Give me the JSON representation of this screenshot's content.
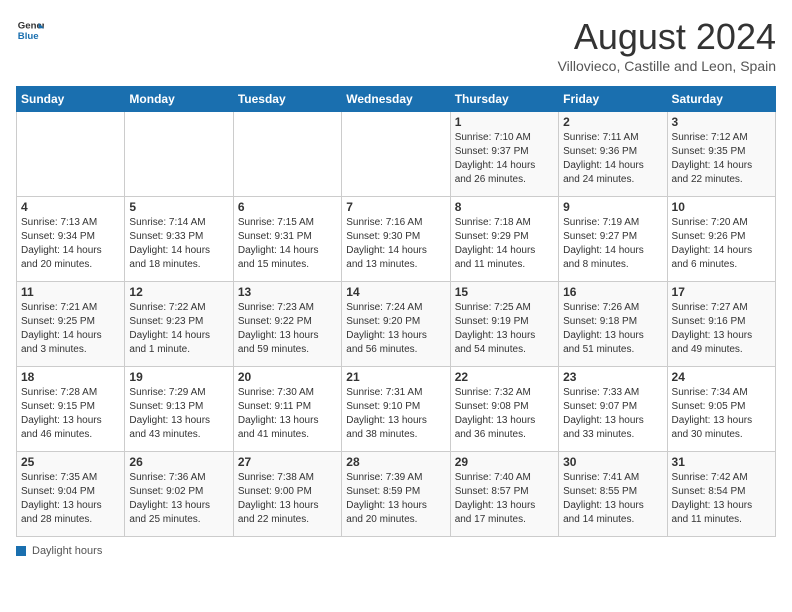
{
  "header": {
    "logo_line1": "General",
    "logo_line2": "Blue",
    "month_year": "August 2024",
    "location": "Villovieco, Castille and Leon, Spain"
  },
  "days_of_week": [
    "Sunday",
    "Monday",
    "Tuesday",
    "Wednesday",
    "Thursday",
    "Friday",
    "Saturday"
  ],
  "footer": {
    "daylight_label": "Daylight hours"
  },
  "weeks": [
    {
      "id": 1,
      "days": [
        {
          "num": "",
          "info": ""
        },
        {
          "num": "",
          "info": ""
        },
        {
          "num": "",
          "info": ""
        },
        {
          "num": "",
          "info": ""
        },
        {
          "num": "1",
          "info": "Sunrise: 7:10 AM\nSunset: 9:37 PM\nDaylight: 14 hours\nand 26 minutes."
        },
        {
          "num": "2",
          "info": "Sunrise: 7:11 AM\nSunset: 9:36 PM\nDaylight: 14 hours\nand 24 minutes."
        },
        {
          "num": "3",
          "info": "Sunrise: 7:12 AM\nSunset: 9:35 PM\nDaylight: 14 hours\nand 22 minutes."
        }
      ]
    },
    {
      "id": 2,
      "days": [
        {
          "num": "4",
          "info": "Sunrise: 7:13 AM\nSunset: 9:34 PM\nDaylight: 14 hours\nand 20 minutes."
        },
        {
          "num": "5",
          "info": "Sunrise: 7:14 AM\nSunset: 9:33 PM\nDaylight: 14 hours\nand 18 minutes."
        },
        {
          "num": "6",
          "info": "Sunrise: 7:15 AM\nSunset: 9:31 PM\nDaylight: 14 hours\nand 15 minutes."
        },
        {
          "num": "7",
          "info": "Sunrise: 7:16 AM\nSunset: 9:30 PM\nDaylight: 14 hours\nand 13 minutes."
        },
        {
          "num": "8",
          "info": "Sunrise: 7:18 AM\nSunset: 9:29 PM\nDaylight: 14 hours\nand 11 minutes."
        },
        {
          "num": "9",
          "info": "Sunrise: 7:19 AM\nSunset: 9:27 PM\nDaylight: 14 hours\nand 8 minutes."
        },
        {
          "num": "10",
          "info": "Sunrise: 7:20 AM\nSunset: 9:26 PM\nDaylight: 14 hours\nand 6 minutes."
        }
      ]
    },
    {
      "id": 3,
      "days": [
        {
          "num": "11",
          "info": "Sunrise: 7:21 AM\nSunset: 9:25 PM\nDaylight: 14 hours\nand 3 minutes."
        },
        {
          "num": "12",
          "info": "Sunrise: 7:22 AM\nSunset: 9:23 PM\nDaylight: 14 hours\nand 1 minute."
        },
        {
          "num": "13",
          "info": "Sunrise: 7:23 AM\nSunset: 9:22 PM\nDaylight: 13 hours\nand 59 minutes."
        },
        {
          "num": "14",
          "info": "Sunrise: 7:24 AM\nSunset: 9:20 PM\nDaylight: 13 hours\nand 56 minutes."
        },
        {
          "num": "15",
          "info": "Sunrise: 7:25 AM\nSunset: 9:19 PM\nDaylight: 13 hours\nand 54 minutes."
        },
        {
          "num": "16",
          "info": "Sunrise: 7:26 AM\nSunset: 9:18 PM\nDaylight: 13 hours\nand 51 minutes."
        },
        {
          "num": "17",
          "info": "Sunrise: 7:27 AM\nSunset: 9:16 PM\nDaylight: 13 hours\nand 49 minutes."
        }
      ]
    },
    {
      "id": 4,
      "days": [
        {
          "num": "18",
          "info": "Sunrise: 7:28 AM\nSunset: 9:15 PM\nDaylight: 13 hours\nand 46 minutes."
        },
        {
          "num": "19",
          "info": "Sunrise: 7:29 AM\nSunset: 9:13 PM\nDaylight: 13 hours\nand 43 minutes."
        },
        {
          "num": "20",
          "info": "Sunrise: 7:30 AM\nSunset: 9:11 PM\nDaylight: 13 hours\nand 41 minutes."
        },
        {
          "num": "21",
          "info": "Sunrise: 7:31 AM\nSunset: 9:10 PM\nDaylight: 13 hours\nand 38 minutes."
        },
        {
          "num": "22",
          "info": "Sunrise: 7:32 AM\nSunset: 9:08 PM\nDaylight: 13 hours\nand 36 minutes."
        },
        {
          "num": "23",
          "info": "Sunrise: 7:33 AM\nSunset: 9:07 PM\nDaylight: 13 hours\nand 33 minutes."
        },
        {
          "num": "24",
          "info": "Sunrise: 7:34 AM\nSunset: 9:05 PM\nDaylight: 13 hours\nand 30 minutes."
        }
      ]
    },
    {
      "id": 5,
      "days": [
        {
          "num": "25",
          "info": "Sunrise: 7:35 AM\nSunset: 9:04 PM\nDaylight: 13 hours\nand 28 minutes."
        },
        {
          "num": "26",
          "info": "Sunrise: 7:36 AM\nSunset: 9:02 PM\nDaylight: 13 hours\nand 25 minutes."
        },
        {
          "num": "27",
          "info": "Sunrise: 7:38 AM\nSunset: 9:00 PM\nDaylight: 13 hours\nand 22 minutes."
        },
        {
          "num": "28",
          "info": "Sunrise: 7:39 AM\nSunset: 8:59 PM\nDaylight: 13 hours\nand 20 minutes."
        },
        {
          "num": "29",
          "info": "Sunrise: 7:40 AM\nSunset: 8:57 PM\nDaylight: 13 hours\nand 17 minutes."
        },
        {
          "num": "30",
          "info": "Sunrise: 7:41 AM\nSunset: 8:55 PM\nDaylight: 13 hours\nand 14 minutes."
        },
        {
          "num": "31",
          "info": "Sunrise: 7:42 AM\nSunset: 8:54 PM\nDaylight: 13 hours\nand 11 minutes."
        }
      ]
    }
  ]
}
